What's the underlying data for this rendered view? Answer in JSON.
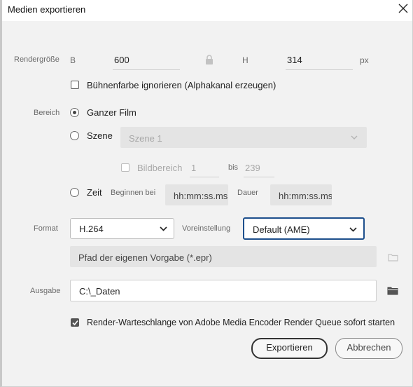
{
  "window": {
    "title": "Medien exportieren",
    "close_icon": "close-icon"
  },
  "render_size": {
    "label": "Rendergröße",
    "width_label": "B",
    "width_value": "600",
    "lock_icon": "lock-icon",
    "height_label": "H",
    "height_value": "314",
    "unit": "px"
  },
  "stage_color": {
    "label": "Bühnenfarbe ignorieren (Alphakanal erzeugen)",
    "checked": false
  },
  "range": {
    "label": "Bereich",
    "full_movie_label": "Ganzer Film",
    "scene_label": "Szene",
    "scene_select_value": "Szene 1",
    "frame_range_label": "Bildbereich",
    "frame_from": "1",
    "to_label": "bis",
    "frame_to": "239",
    "time_label": "Zeit",
    "start_label": "Beginnen bei",
    "start_placeholder": "hh:mm:ss.ms",
    "duration_label": "Dauer",
    "duration_placeholder": "hh:mm:ss.ms",
    "selected": "Ganzer Film"
  },
  "format": {
    "label": "Format",
    "value": "H.264",
    "preset_label": "Voreinstellung",
    "preset_value": "Default (AME)",
    "custom_preset_placeholder": "Pfad der eigenen Vorgabe (*.epr)"
  },
  "output": {
    "label": "Ausgabe",
    "path": "C:\\_Daten",
    "folder_icon": "folder-icon"
  },
  "render_queue": {
    "label": "Render-Warteschlange von Adobe Media Encoder Render Queue sofort starten",
    "checked": true
  },
  "buttons": {
    "export": "Exportieren",
    "cancel": "Abbrechen"
  }
}
